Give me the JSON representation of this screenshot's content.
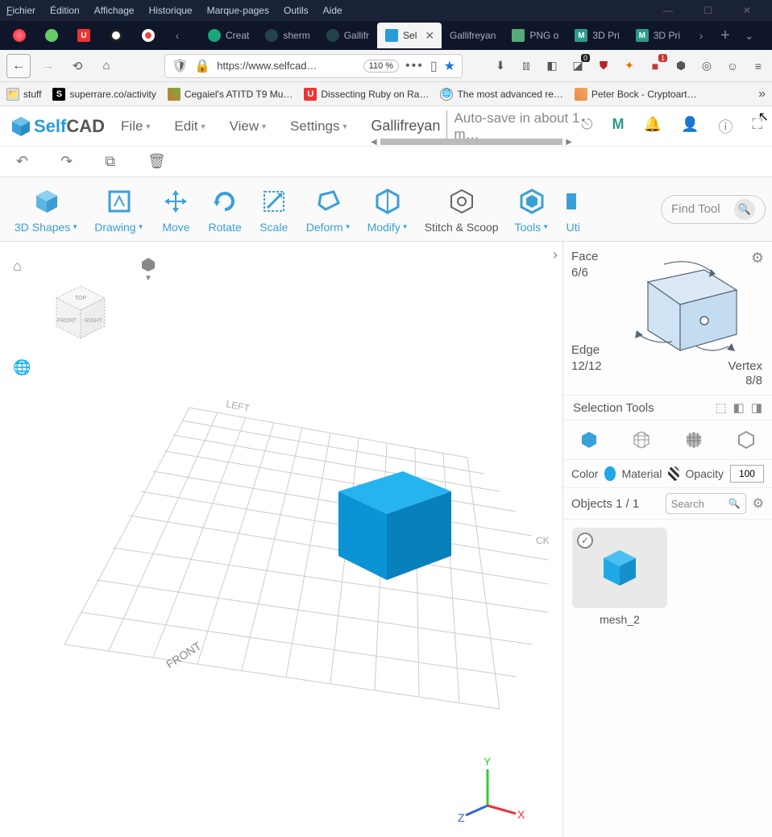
{
  "os_menu": {
    "file": "Fichier",
    "edit": "Édition",
    "view": "Affichage",
    "history": "Historique",
    "bookmarks": "Marque-pages",
    "tools": "Outils",
    "help": "Aide"
  },
  "browser_tabs": {
    "icon_only_count": 5,
    "left_arrow_label": "‹",
    "right_arrow_label": "›",
    "tabs": [
      {
        "label": "Creat",
        "color": "#1aa57d"
      },
      {
        "label": "sherm",
        "color": "#23424a"
      },
      {
        "label": "Gallifr",
        "color": "#23424a"
      },
      {
        "label": "Sel",
        "color": "#2a9cd8",
        "active": true
      },
      {
        "label": "Gallifreyan",
        "color": "#777",
        "noicon": true
      },
      {
        "label": "PNG o",
        "color": "#5a7"
      },
      {
        "label": "3D Pri",
        "color": "#2a9c8a",
        "m": true
      },
      {
        "label": "3D Pri",
        "color": "#2a9c8a",
        "m": true
      }
    ]
  },
  "url_bar": {
    "address": "https://www.selfcad…",
    "zoom": "110 %"
  },
  "ext_badges": {
    "a": "0",
    "b": "1"
  },
  "bookmarks": [
    {
      "label": "stuff",
      "icon": "folder"
    },
    {
      "label": "superrare.co/activity",
      "icon": "S"
    },
    {
      "label": "Cegaiel's ATITD T9 Mu…",
      "icon": "img1"
    },
    {
      "label": "Dissecting Ruby on Ra…",
      "icon": "U"
    },
    {
      "label": "The most advanced re…",
      "icon": "globe"
    },
    {
      "label": "Peter Bock - Cryptoart…",
      "icon": "img2"
    }
  ],
  "app": {
    "logo_a": "Self",
    "logo_b": "CAD",
    "menus": [
      "File",
      "Edit",
      "View",
      "Settings"
    ],
    "project": "Gallifreyan",
    "autosave": "Auto-save in about 1 m…"
  },
  "right_icons": [
    "share",
    "m-icon",
    "bell",
    "user",
    "info",
    "fullscreen"
  ],
  "tools": [
    {
      "label": "3D Shapes",
      "caret": true
    },
    {
      "label": "Drawing",
      "caret": true
    },
    {
      "label": "Move"
    },
    {
      "label": "Rotate"
    },
    {
      "label": "Scale"
    },
    {
      "label": "Deform",
      "caret": true
    },
    {
      "label": "Modify",
      "caret": true
    },
    {
      "label": "Stitch & Scoop",
      "dark": true
    },
    {
      "label": "Tools",
      "caret": true
    },
    {
      "label": "Uti"
    }
  ],
  "find_tool": "Find Tool",
  "viewcube": {
    "top": "TOP",
    "front": "FRONT",
    "right": "RIGHT"
  },
  "grid_labels": {
    "front": "FRONT",
    "left": "LEFT",
    "back": "CK"
  },
  "axes": {
    "x": "X",
    "y": "Y",
    "z": "Z"
  },
  "topo": {
    "face_label": "Face",
    "face_count": "6/6",
    "edge_label": "Edge",
    "edge_count": "12/12",
    "vertex_label": "Vertex",
    "vertex_count": "8/8"
  },
  "selection_tools": "Selection Tools",
  "material": {
    "color": "Color",
    "material": "Material",
    "opacity": "Opacity",
    "opacity_val": "100"
  },
  "objects": {
    "header": "Objects 1 / 1",
    "search": "Search",
    "item": "mesh_2"
  }
}
